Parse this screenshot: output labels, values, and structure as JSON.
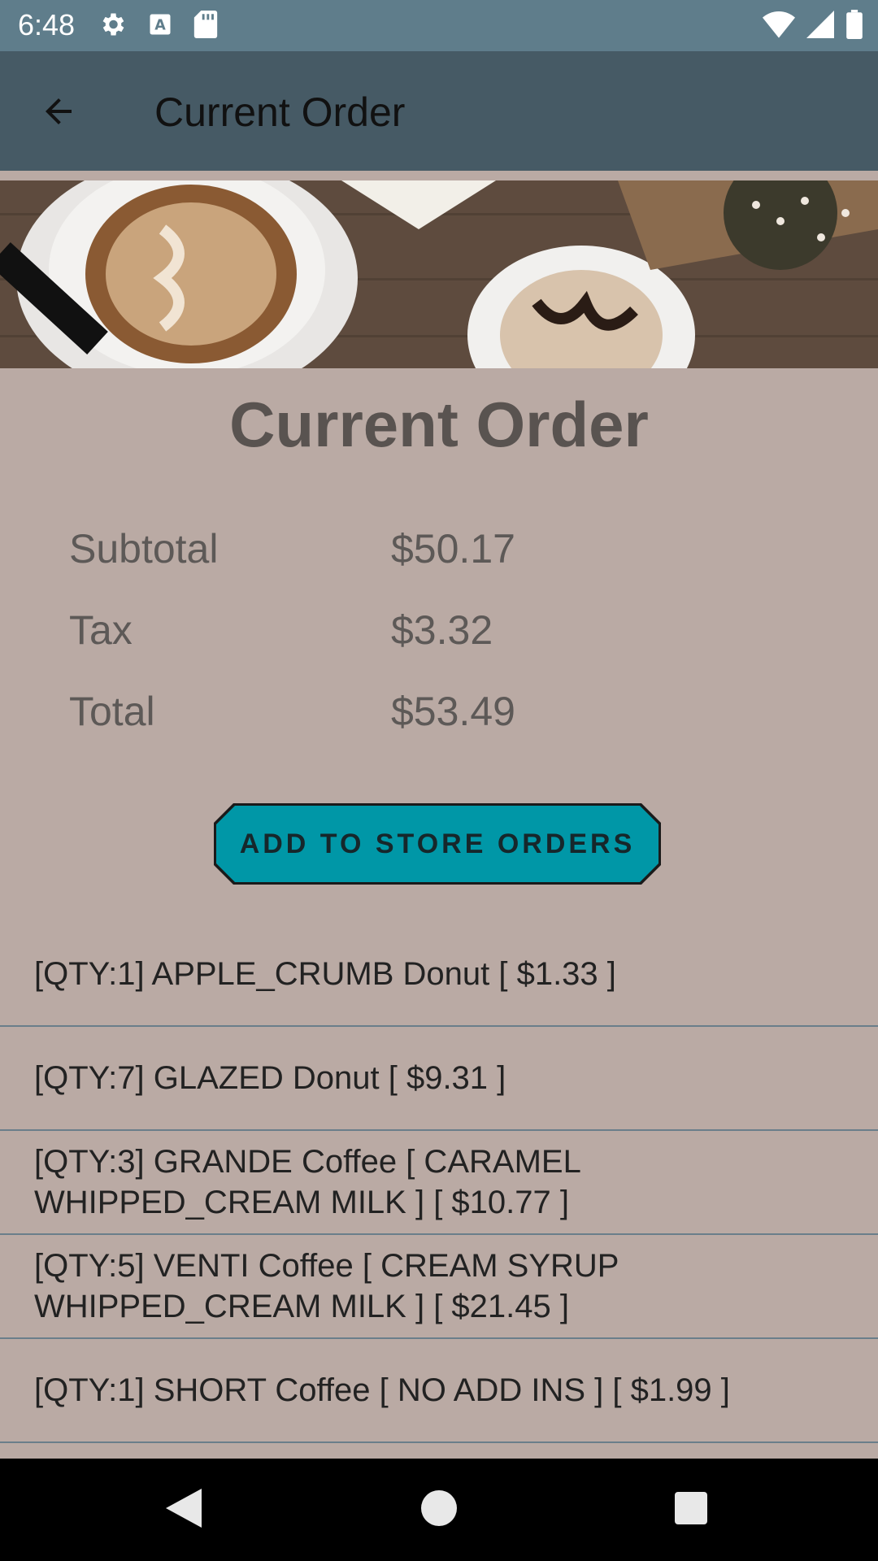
{
  "status_bar": {
    "time": "6:48",
    "icons_left": [
      "settings-icon",
      "font-a-icon",
      "sd-card-icon"
    ],
    "icons_right": [
      "wifi-icon",
      "cellular-signal-icon",
      "battery-icon"
    ]
  },
  "app_bar": {
    "title": "Current Order",
    "back_icon": "arrow-back-icon"
  },
  "hero_image": {
    "description_icon": "coffee-donut-image"
  },
  "main": {
    "title": "Current Order",
    "summary": [
      {
        "label": "Subtotal",
        "value": "$50.17"
      },
      {
        "label": "Tax",
        "value": "$3.32"
      },
      {
        "label": "Total",
        "value": "$53.49"
      }
    ],
    "cta_label": "ADD TO STORE ORDERS"
  },
  "order_items": [
    "[QTY:1] APPLE_CRUMB Donut [ $1.33 ]",
    "[QTY:7] GLAZED Donut [ $9.31 ]",
    "[QTY:3] GRANDE Coffee [ CARAMEL WHIPPED_CREAM MILK ] [ $10.77 ]",
    "[QTY:5] VENTI Coffee [ CREAM SYRUP WHIPPED_CREAM MILK ] [ $21.45 ]",
    "[QTY:1] SHORT Coffee [ NO ADD INS ]  [ $1.99 ]"
  ],
  "colors": {
    "status_bar": "#5f7d8b",
    "app_bar": "#465a65",
    "background": "#baaaa4",
    "accent_button": "#0097a7",
    "divider": "#6a7e8a"
  },
  "nav_bar": {
    "back": "nav-back-icon",
    "home": "nav-home-icon",
    "recents": "nav-recents-icon"
  }
}
